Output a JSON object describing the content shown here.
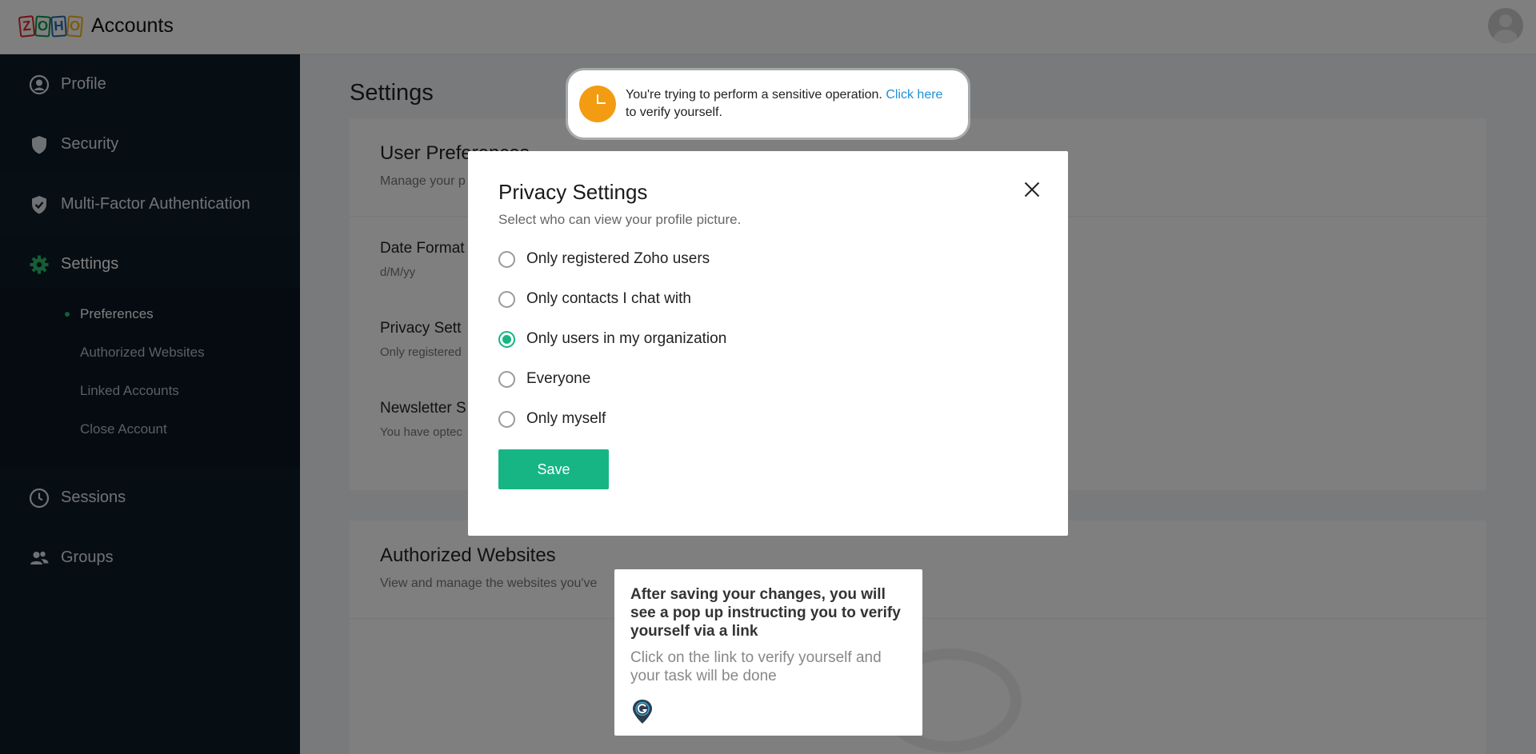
{
  "header": {
    "logo_letters": [
      "Z",
      "O",
      "H",
      "O"
    ],
    "app_name": "Accounts"
  },
  "sidebar": {
    "items": [
      {
        "label": "Profile",
        "icon": "profile-icon"
      },
      {
        "label": "Security",
        "icon": "shield-icon"
      },
      {
        "label": "Multi-Factor Authentication",
        "icon": "shield-check-icon"
      },
      {
        "label": "Settings",
        "icon": "gear-icon",
        "active": true
      },
      {
        "label": "Sessions",
        "icon": "clock-icon"
      },
      {
        "label": "Groups",
        "icon": "group-icon"
      }
    ],
    "subitems": [
      {
        "label": "Preferences",
        "active": true
      },
      {
        "label": "Authorized Websites"
      },
      {
        "label": "Linked Accounts"
      },
      {
        "label": "Close Account"
      }
    ]
  },
  "main": {
    "title": "Settings",
    "preferences_card": {
      "title": "User Preferences",
      "subtitle": "Manage your p",
      "rows": [
        {
          "title": "Date Format",
          "value": "d/M/yy"
        },
        {
          "title": "Privacy Sett",
          "value": "Only registered"
        },
        {
          "title": "Newsletter S",
          "value": "You have optec"
        }
      ]
    },
    "websites_card": {
      "title": "Authorized Websites",
      "subtitle": "View and manage the websites you've"
    }
  },
  "toast": {
    "text_before": "You're trying to perform a sensitive operation. ",
    "link_text": "Click here",
    "text_after": " to verify yourself."
  },
  "modal": {
    "title": "Privacy Settings",
    "subtitle": "Select who can view your profile picture.",
    "options": [
      {
        "label": "Only registered Zoho users",
        "selected": false
      },
      {
        "label": "Only contacts I chat with",
        "selected": false
      },
      {
        "label": "Only users in my organization",
        "selected": true
      },
      {
        "label": "Everyone",
        "selected": false
      },
      {
        "label": "Only myself",
        "selected": false
      }
    ],
    "save_label": "Save"
  },
  "tooltip": {
    "heading": "After saving your changes, you will see a pop up instructing you to verify yourself via a link",
    "body": "Click on the link to verify yourself and your task will be done"
  },
  "colors": {
    "accent_green": "#17b583",
    "sidebar_bg": "#0d1b26",
    "toast_icon": "#f39c12",
    "link": "#1f8fd6"
  }
}
